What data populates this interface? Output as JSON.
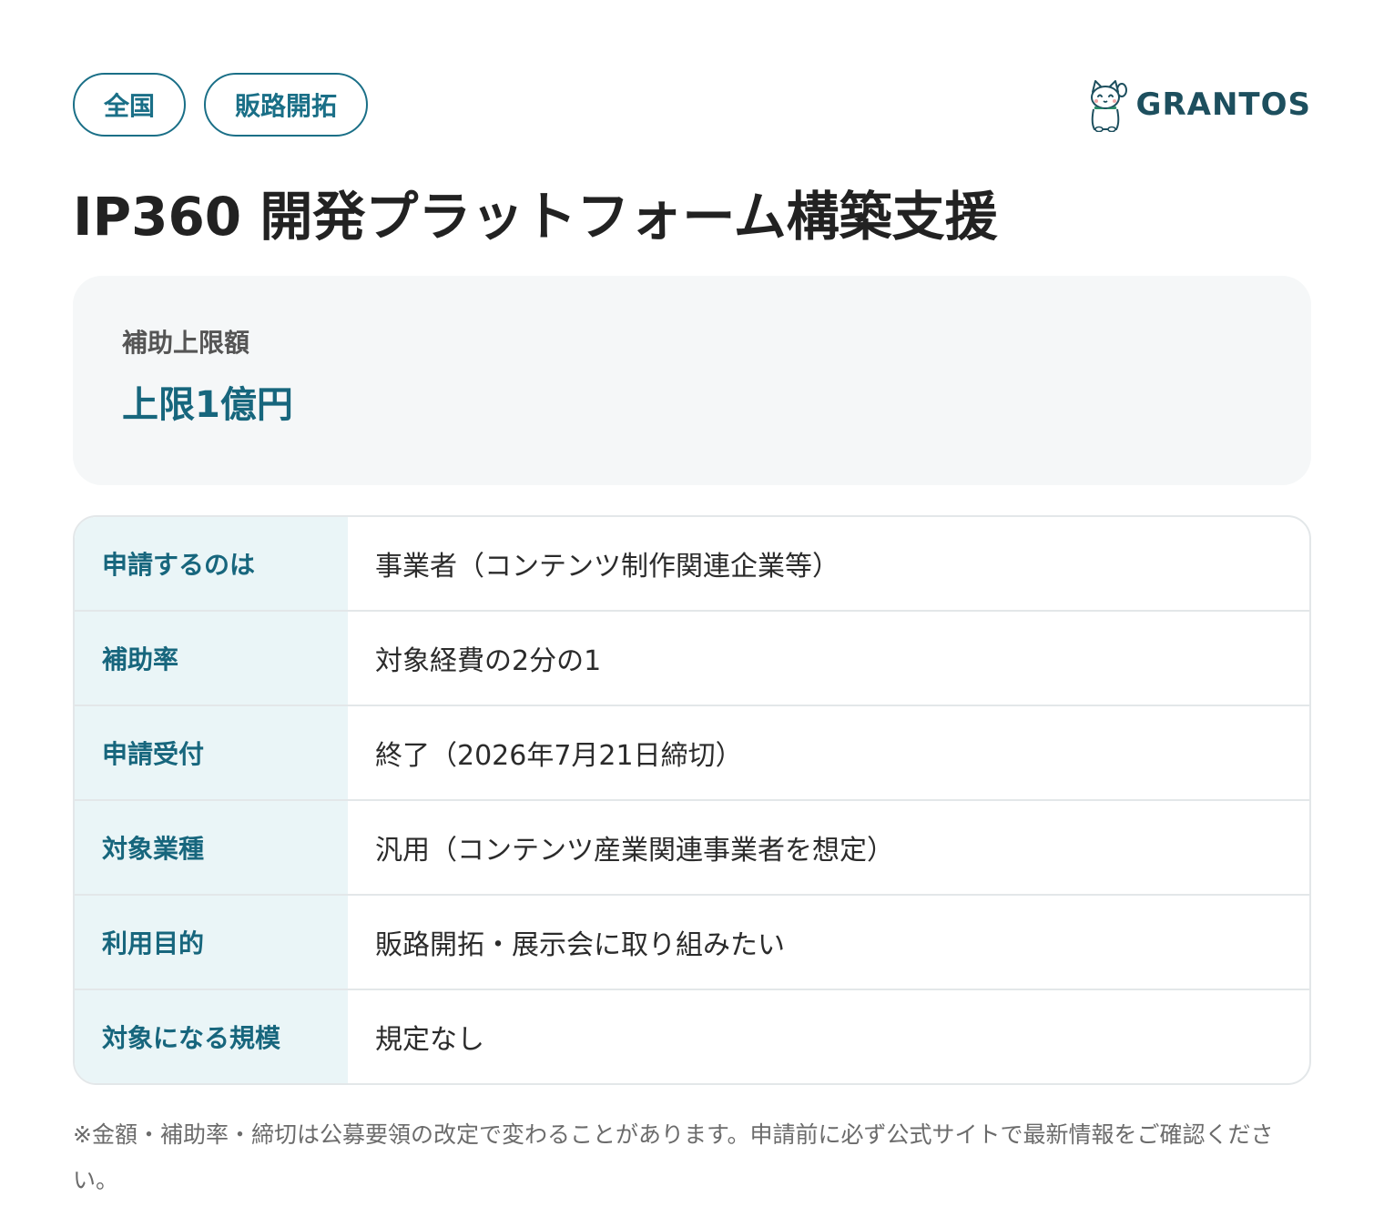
{
  "header": {
    "tags": [
      "全国",
      "販路開拓"
    ],
    "brand": {
      "name": "GRANTOS",
      "logo_icon": "maneki-neko-cat-icon",
      "accent_color": "#1d4f5e"
    }
  },
  "title": "IP360 開発プラットフォーム構築支援",
  "amount": {
    "label": "補助上限額",
    "value": "上限1億円"
  },
  "details": [
    {
      "label": "申請するのは",
      "value": "事業者（コンテンツ制作関連企業等）"
    },
    {
      "label": "補助率",
      "value": "対象経費の2分の1"
    },
    {
      "label": "申請受付",
      "value": "終了（2026年7月21日締切）"
    },
    {
      "label": "対象業種",
      "value": "汎用（コンテンツ産業関連事業者を想定）"
    },
    {
      "label": "利用目的",
      "value": "販路開拓・展示会に取り組みたい"
    },
    {
      "label": "対象になる規模",
      "value": "規定なし"
    }
  ],
  "note": "※金額・補助率・締切は公募要領の改定で変わることがあります。申請前に必ず公式サイトで最新情報をご確認ください。",
  "colors": {
    "primary": "#17667d",
    "label_bg": "#eaf5f7",
    "card_bg": "#f5f7f8",
    "border": "#e3e7e9"
  }
}
